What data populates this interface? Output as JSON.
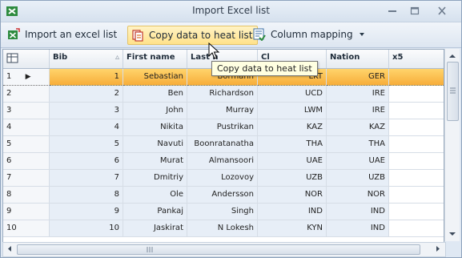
{
  "window": {
    "title": "Import Excel list",
    "icon": "excel-icon"
  },
  "toolbar": {
    "import_label": "Import an excel list",
    "copy_label": "Copy data to heat list",
    "mapping_label": "Column mapping"
  },
  "tooltip": {
    "text": "Copy data to heat list"
  },
  "grid": {
    "columns": [
      "Bib",
      "First name",
      "Last name",
      "Club",
      "Nation",
      "x5"
    ],
    "header_visible": {
      "last_name": "Last n",
      "club": "Cl"
    },
    "selected_row": 1,
    "rows": [
      {
        "row": "1",
        "bib": "1",
        "first": "Sebastian",
        "last": "Bormann",
        "club": "LKT",
        "nation": "GER"
      },
      {
        "row": "2",
        "bib": "2",
        "first": "Ben",
        "last": "Richardson",
        "club": "UCD",
        "nation": "IRE"
      },
      {
        "row": "3",
        "bib": "3",
        "first": "John",
        "last": "Murray",
        "club": "LWM",
        "nation": "IRE"
      },
      {
        "row": "4",
        "bib": "4",
        "first": "Nikita",
        "last": "Pustrikan",
        "club": "KAZ",
        "nation": "KAZ"
      },
      {
        "row": "5",
        "bib": "5",
        "first": "Navuti",
        "last": "Boonratanatha",
        "club": "THA",
        "nation": "THA"
      },
      {
        "row": "6",
        "bib": "6",
        "first": "Murat",
        "last": "Almansoori",
        "club": "UAE",
        "nation": "UAE"
      },
      {
        "row": "7",
        "bib": "7",
        "first": "Dmitriy",
        "last": "Lozovoy",
        "club": "UZB",
        "nation": "UZB"
      },
      {
        "row": "8",
        "bib": "8",
        "first": "Ole",
        "last": "Andersson",
        "club": "NOR",
        "nation": "NOR"
      },
      {
        "row": "9",
        "bib": "9",
        "first": "Pankaj",
        "last": "Singh",
        "club": "IND",
        "nation": "IND"
      },
      {
        "row": "10",
        "bib": "10",
        "first": "Jaskirat",
        "last": "N Lokesh",
        "club": "KYN",
        "nation": "IND"
      }
    ]
  },
  "colors": {
    "selection": "#f7ad3a",
    "cell_bg": "#e7eef7",
    "accent_green": "#1e8c3a"
  }
}
